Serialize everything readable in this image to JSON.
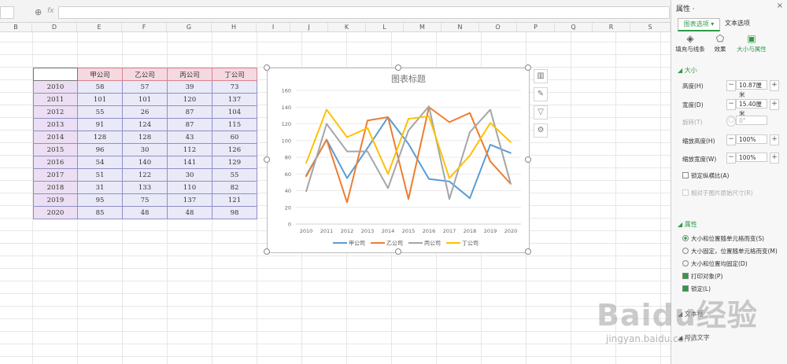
{
  "formula_bar": {
    "fx": "fx"
  },
  "columns": [
    "B",
    "D",
    "E",
    "F",
    "G",
    "H",
    "I",
    "J",
    "K",
    "L",
    "M",
    "N",
    "O",
    "P",
    "Q",
    "R",
    "S"
  ],
  "table": {
    "headers": [
      "甲公司",
      "乙公司",
      "丙公司",
      "丁公司"
    ],
    "rows": [
      {
        "year": "2010",
        "v": [
          "58",
          "57",
          "39",
          "73"
        ]
      },
      {
        "year": "2011",
        "v": [
          "101",
          "101",
          "120",
          "137"
        ]
      },
      {
        "year": "2012",
        "v": [
          "55",
          "26",
          "87",
          "104"
        ]
      },
      {
        "year": "2013",
        "v": [
          "91",
          "124",
          "87",
          "115"
        ]
      },
      {
        "year": "2014",
        "v": [
          "128",
          "128",
          "43",
          "60"
        ]
      },
      {
        "year": "2015",
        "v": [
          "96",
          "30",
          "112",
          "126"
        ]
      },
      {
        "year": "2016",
        "v": [
          "54",
          "140",
          "141",
          "129"
        ]
      },
      {
        "year": "2017",
        "v": [
          "51",
          "122",
          "30",
          "55"
        ]
      },
      {
        "year": "2018",
        "v": [
          "31",
          "133",
          "110",
          "82"
        ]
      },
      {
        "year": "2019",
        "v": [
          "95",
          "75",
          "137",
          "121"
        ]
      },
      {
        "year": "2020",
        "v": [
          "85",
          "48",
          "48",
          "98"
        ]
      }
    ]
  },
  "chart_data": {
    "type": "line",
    "title": "图表标题",
    "categories": [
      "2010",
      "2011",
      "2012",
      "2013",
      "2014",
      "2015",
      "2016",
      "2017",
      "2018",
      "2019",
      "2020"
    ],
    "ylim": [
      0,
      160
    ],
    "yticks": [
      "0",
      "20",
      "40",
      "60",
      "80",
      "100",
      "120",
      "140",
      "160"
    ],
    "grid": true,
    "legend": "bottom",
    "series": [
      {
        "name": "甲公司",
        "color": "#5b9bd5",
        "values": [
          58,
          101,
          55,
          91,
          128,
          96,
          54,
          51,
          31,
          95,
          85
        ]
      },
      {
        "name": "乙公司",
        "color": "#ed7d31",
        "values": [
          57,
          101,
          26,
          124,
          128,
          30,
          140,
          122,
          133,
          75,
          48
        ]
      },
      {
        "name": "丙公司",
        "color": "#a5a5a5",
        "values": [
          39,
          120,
          87,
          87,
          43,
          112,
          141,
          30,
          110,
          137,
          48
        ]
      },
      {
        "name": "丁公司",
        "color": "#ffc000",
        "values": [
          73,
          137,
          104,
          115,
          60,
          126,
          129,
          55,
          82,
          121,
          98
        ]
      }
    ]
  },
  "panel": {
    "title": "属性 ·",
    "close": "×",
    "tab_chart_options": "图表选项 ▾",
    "tab_text_options": "文本选项",
    "subtabs": [
      "填充与线条",
      "效果",
      "大小与属性"
    ],
    "section_size": "◢ 大小",
    "height_label": "高度(H)",
    "height_value": "10.87厘米",
    "width_label": "宽度(D)",
    "width_value": "15.40厘米",
    "rotate_label": "旋转(T)",
    "rotate_value": "0°",
    "scale_h_label": "缩放高度(H)",
    "scale_h_value": "100%",
    "scale_w_label": "缩放宽度(W)",
    "scale_w_value": "100%",
    "lock_ratio": "锁定纵横比(A)",
    "relative_original": "相对于图片原始尺寸(R)",
    "section_props": "◢ 属性",
    "radio1": "大小和位置随单元格而变(S)",
    "radio2": "大小固定，位置随单元格而变(M)",
    "radio3": "大小和位置均固定(D)",
    "print_object": "打印对象(P)",
    "locked": "锁定(L)",
    "text_box": "◢ 文本框",
    "alt_text": "◢ 可选文字"
  },
  "watermark": {
    "main": "Baidu经验",
    "sub": "jingyan.baidu.com"
  }
}
